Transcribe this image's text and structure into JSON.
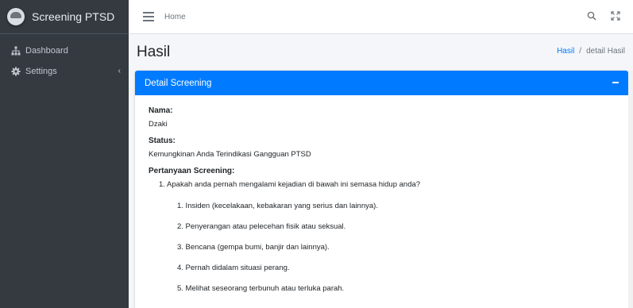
{
  "brand": {
    "name": "Screening PTSD"
  },
  "sidebar": {
    "items": [
      {
        "label": "Dashboard",
        "icon": "sitemap-icon"
      },
      {
        "label": "Settings",
        "icon": "gear-icon",
        "caret": "‹"
      }
    ]
  },
  "topbar": {
    "home_label": "Home"
  },
  "page": {
    "title": "Hasil"
  },
  "breadcrumb": {
    "link": "Hasil",
    "separator": "/",
    "current": "detail Hasil"
  },
  "card": {
    "title": "Detail Screening",
    "nama_label": "Nama:",
    "nama_value": "Dzaki",
    "status_label": "Status:",
    "status_value": "Kemungkinan Anda Terindikasi Gangguan PTSD",
    "pertanyaan_label": "Pertanyaan Screening:",
    "question_main": "1. Apakah anda pernah mengalami kejadian di bawah ini semasa hidup anda?",
    "sub_items": [
      "1. Insiden (kecelakaan, kebakaran yang serius dan lainnya).",
      "2. Penyerangan atau pelecehan fisik atau seksual.",
      "3. Bencana (gempa bumi, banjir dan lainnya).",
      "4. Pernah didalam situasi perang.",
      "5. Melihat seseorang terbunuh atau terluka parah."
    ]
  },
  "colors": {
    "accent": "#007bff",
    "sidebar_bg": "#343a40"
  }
}
